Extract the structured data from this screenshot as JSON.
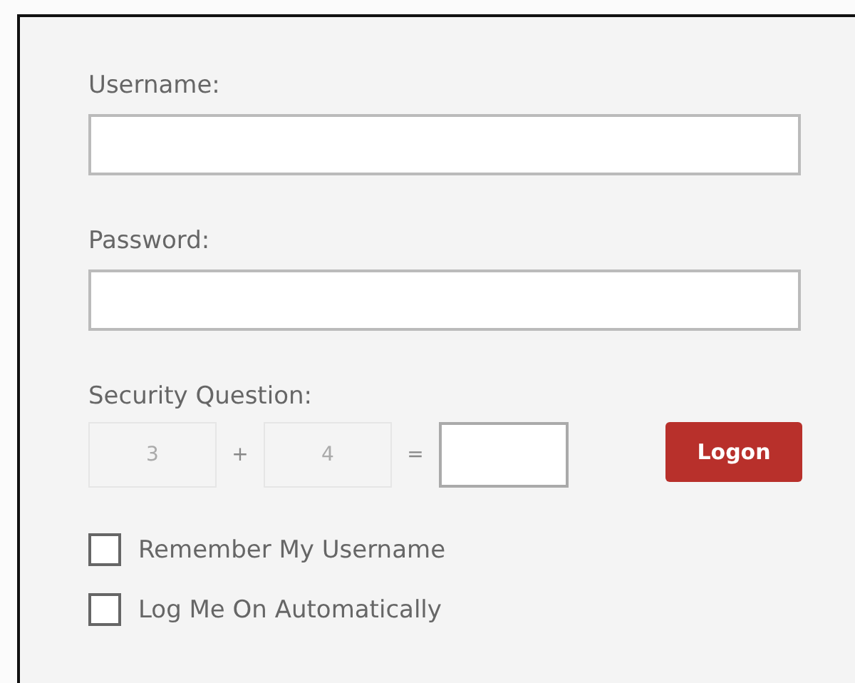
{
  "username": {
    "label": "Username:"
  },
  "password": {
    "label": "Password:"
  },
  "security_question": {
    "label": "Security Question:",
    "operand_1": "3",
    "operator": "+",
    "operand_2": "4",
    "equals": "="
  },
  "logon_button": "Logon",
  "options": [
    {
      "label": "Remember My Username",
      "checked": false
    },
    {
      "label": "Log Me On Automatically",
      "checked": false
    }
  ]
}
